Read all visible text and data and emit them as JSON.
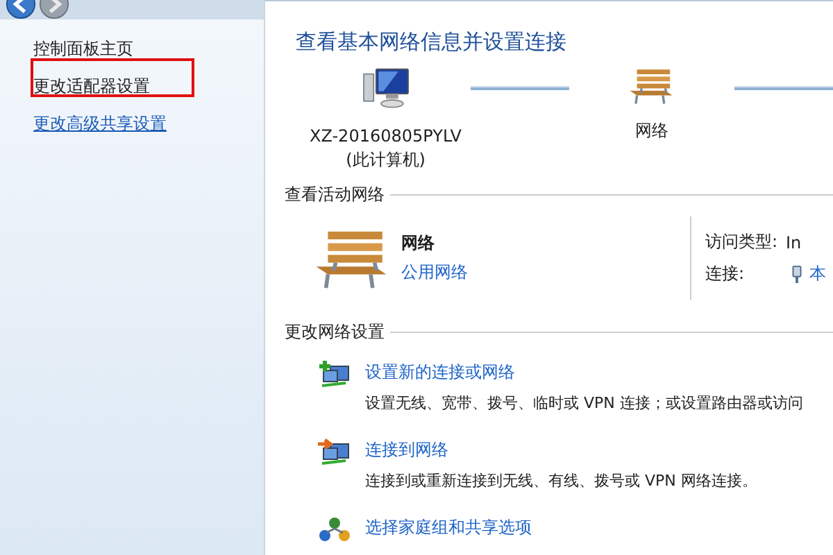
{
  "toolbar": {
    "buttons": [
      {
        "kind": "back"
      },
      {
        "kind": "forward"
      }
    ]
  },
  "sidebar": {
    "items": [
      {
        "label": "控制面板主页",
        "kind": "plain",
        "highlighted": false
      },
      {
        "label": "更改适配器设置",
        "kind": "plain",
        "highlighted": true
      },
      {
        "label": "更改高级共享设置",
        "kind": "link",
        "highlighted": false
      }
    ]
  },
  "main": {
    "title": "查看基本网络信息并设置连接",
    "network_map": {
      "nodes": [
        {
          "kind": "computer",
          "label": "XZ-20160805PYLV",
          "sublabel": "(此计算机)"
        },
        {
          "kind": "network",
          "label": "网络"
        }
      ]
    },
    "active_networks": {
      "heading": "查看活动网络",
      "name": "网络",
      "type": "公用网络",
      "details": [
        {
          "label": "访问类型:",
          "value": "In",
          "kind": "text"
        },
        {
          "label": "连接:",
          "value": "本",
          "kind": "link"
        }
      ]
    },
    "change_settings": {
      "heading": "更改网络设置",
      "tasks": [
        {
          "kind": "new-connection",
          "title": "设置新的连接或网络",
          "description": "设置无线、宽带、拨号、临时或 VPN 连接；或设置路由器或访问"
        },
        {
          "kind": "connect",
          "title": "连接到网络",
          "description": "连接到或重新连接到无线、有线、拨号或 VPN 网络连接。"
        },
        {
          "kind": "homegroup",
          "title": "选择家庭组和共享选项"
        }
      ]
    }
  }
}
